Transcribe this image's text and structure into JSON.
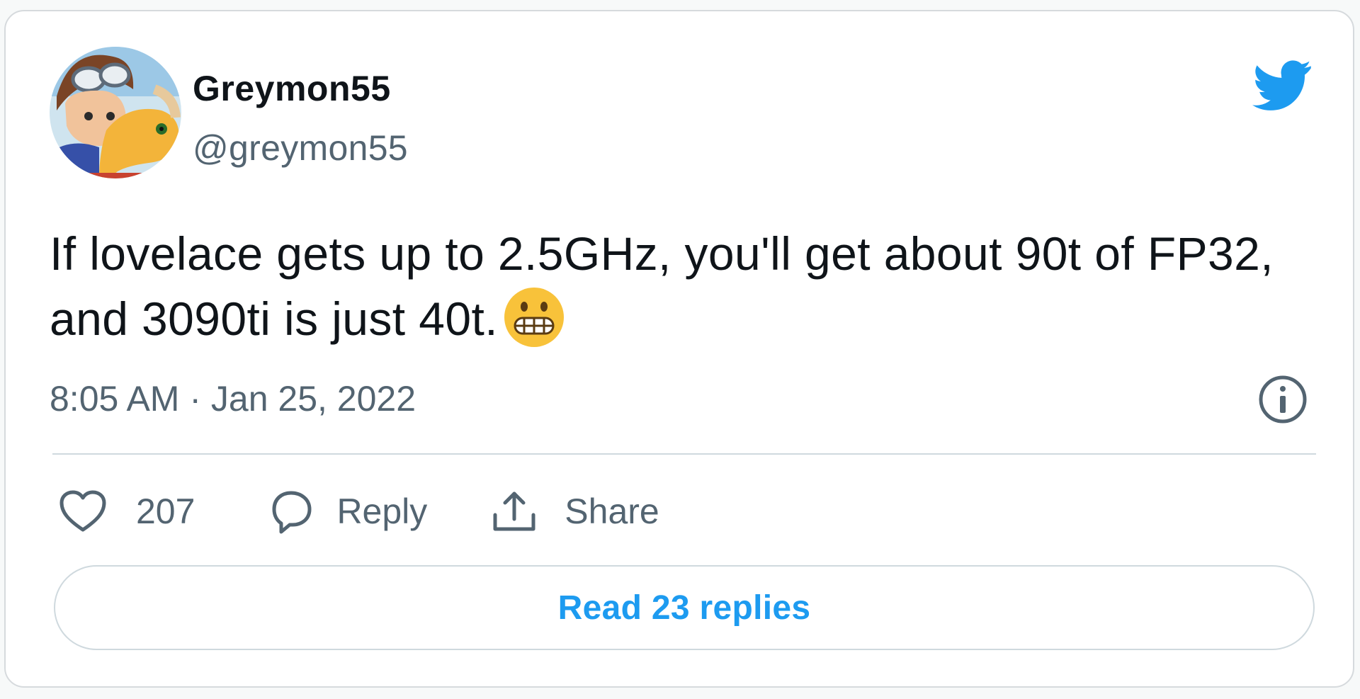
{
  "author": {
    "display_name": "Greymon55",
    "handle": "@greymon55",
    "avatar_icon": "anime-avatar"
  },
  "tweet": {
    "text": "If lovelace gets up to 2.5GHz, you'll get about 90t of FP32, and 3090ti is just 40t.",
    "emoji": "grimacing-face-emoji",
    "timestamp": "8:05 AM · Jan 25, 2022"
  },
  "actions": {
    "like_count": "207",
    "reply_label": "Reply",
    "share_label": "Share"
  },
  "read_replies_label": "Read 23 replies",
  "colors": {
    "accent": "#1d9bf0",
    "text_primary": "#0f1419",
    "text_secondary": "#536471",
    "border": "#cfd9de"
  },
  "icons": [
    "twitter-bird-icon",
    "info-icon",
    "heart-icon",
    "reply-bubble-icon",
    "share-icon"
  ]
}
